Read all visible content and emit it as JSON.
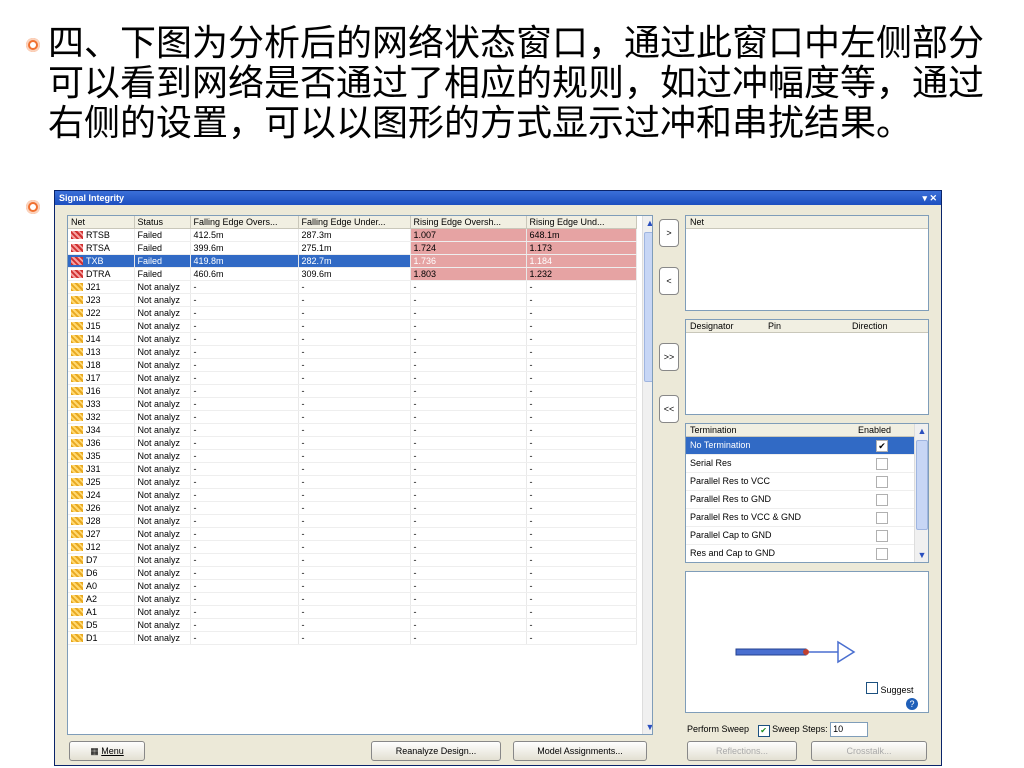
{
  "slide": {
    "text": "四、下图为分析后的网络状态窗口，通过此窗口中左侧部分可以看到网络是否通过了相应的规则，如过冲幅度等，通过右侧的设置，可以以图形的方式显示过冲和串扰结果。"
  },
  "window": {
    "title": "Signal Integrity",
    "controls": "▾ ✕"
  },
  "grid": {
    "columns": [
      "Net",
      "Status",
      "Falling Edge Overs...",
      "Falling Edge Under...",
      "Rising Edge Oversh...",
      "Rising Edge Und..."
    ],
    "rows": [
      {
        "net": "RTSB",
        "status": "Failed",
        "fo": "412.5m",
        "fu": "287.3m",
        "ro": "1.007",
        "ru": "648.1m",
        "type": "fail"
      },
      {
        "net": "RTSA",
        "status": "Failed",
        "fo": "399.6m",
        "fu": "275.1m",
        "ro": "1.724",
        "ru": "1.173",
        "type": "fail"
      },
      {
        "net": "TXB",
        "status": "Failed",
        "fo": "419.8m",
        "fu": "282.7m",
        "ro": "1.736",
        "ru": "1.184",
        "type": "fail",
        "selected": true
      },
      {
        "net": "DTRA",
        "status": "Failed",
        "fo": "460.6m",
        "fu": "309.6m",
        "ro": "1.803",
        "ru": "1.232",
        "type": "fail"
      },
      {
        "net": "J21",
        "status": "Not analyz",
        "fo": "-",
        "fu": "-",
        "ro": "-",
        "ru": "-",
        "type": "na"
      },
      {
        "net": "J23",
        "status": "Not analyz",
        "fo": "-",
        "fu": "-",
        "ro": "-",
        "ru": "-",
        "type": "na"
      },
      {
        "net": "J22",
        "status": "Not analyz",
        "fo": "-",
        "fu": "-",
        "ro": "-",
        "ru": "-",
        "type": "na"
      },
      {
        "net": "J15",
        "status": "Not analyz",
        "fo": "-",
        "fu": "-",
        "ro": "-",
        "ru": "-",
        "type": "na"
      },
      {
        "net": "J14",
        "status": "Not analyz",
        "fo": "-",
        "fu": "-",
        "ro": "-",
        "ru": "-",
        "type": "na"
      },
      {
        "net": "J13",
        "status": "Not analyz",
        "fo": "-",
        "fu": "-",
        "ro": "-",
        "ru": "-",
        "type": "na"
      },
      {
        "net": "J18",
        "status": "Not analyz",
        "fo": "-",
        "fu": "-",
        "ro": "-",
        "ru": "-",
        "type": "na"
      },
      {
        "net": "J17",
        "status": "Not analyz",
        "fo": "-",
        "fu": "-",
        "ro": "-",
        "ru": "-",
        "type": "na"
      },
      {
        "net": "J16",
        "status": "Not analyz",
        "fo": "-",
        "fu": "-",
        "ro": "-",
        "ru": "-",
        "type": "na"
      },
      {
        "net": "J33",
        "status": "Not analyz",
        "fo": "-",
        "fu": "-",
        "ro": "-",
        "ru": "-",
        "type": "na"
      },
      {
        "net": "J32",
        "status": "Not analyz",
        "fo": "-",
        "fu": "-",
        "ro": "-",
        "ru": "-",
        "type": "na"
      },
      {
        "net": "J34",
        "status": "Not analyz",
        "fo": "-",
        "fu": "-",
        "ro": "-",
        "ru": "-",
        "type": "na"
      },
      {
        "net": "J36",
        "status": "Not analyz",
        "fo": "-",
        "fu": "-",
        "ro": "-",
        "ru": "-",
        "type": "na"
      },
      {
        "net": "J35",
        "status": "Not analyz",
        "fo": "-",
        "fu": "-",
        "ro": "-",
        "ru": "-",
        "type": "na"
      },
      {
        "net": "J31",
        "status": "Not analyz",
        "fo": "-",
        "fu": "-",
        "ro": "-",
        "ru": "-",
        "type": "na"
      },
      {
        "net": "J25",
        "status": "Not analyz",
        "fo": "-",
        "fu": "-",
        "ro": "-",
        "ru": "-",
        "type": "na"
      },
      {
        "net": "J24",
        "status": "Not analyz",
        "fo": "-",
        "fu": "-",
        "ro": "-",
        "ru": "-",
        "type": "na"
      },
      {
        "net": "J26",
        "status": "Not analyz",
        "fo": "-",
        "fu": "-",
        "ro": "-",
        "ru": "-",
        "type": "na"
      },
      {
        "net": "J28",
        "status": "Not analyz",
        "fo": "-",
        "fu": "-",
        "ro": "-",
        "ru": "-",
        "type": "na"
      },
      {
        "net": "J27",
        "status": "Not analyz",
        "fo": "-",
        "fu": "-",
        "ro": "-",
        "ru": "-",
        "type": "na"
      },
      {
        "net": "J12",
        "status": "Not analyz",
        "fo": "-",
        "fu": "-",
        "ro": "-",
        "ru": "-",
        "type": "na"
      },
      {
        "net": "D7",
        "status": "Not analyz",
        "fo": "-",
        "fu": "-",
        "ro": "-",
        "ru": "-",
        "type": "na"
      },
      {
        "net": "D6",
        "status": "Not analyz",
        "fo": "-",
        "fu": "-",
        "ro": "-",
        "ru": "-",
        "type": "na"
      },
      {
        "net": "A0",
        "status": "Not analyz",
        "fo": "-",
        "fu": "-",
        "ro": "-",
        "ru": "-",
        "type": "na"
      },
      {
        "net": "A2",
        "status": "Not analyz",
        "fo": "-",
        "fu": "-",
        "ro": "-",
        "ru": "-",
        "type": "na"
      },
      {
        "net": "A1",
        "status": "Not analyz",
        "fo": "-",
        "fu": "-",
        "ro": "-",
        "ru": "-",
        "type": "na"
      },
      {
        "net": "D5",
        "status": "Not analyz",
        "fo": "-",
        "fu": "-",
        "ro": "-",
        "ru": "-",
        "type": "na"
      },
      {
        "net": "D1",
        "status": "Not analyz",
        "fo": "-",
        "fu": "-",
        "ro": "-",
        "ru": "-",
        "type": "na"
      }
    ]
  },
  "mid_buttons": [
    ">",
    "<",
    ">>",
    "<<"
  ],
  "right": {
    "net_header": "Net",
    "pin_headers": [
      "Designator",
      "Pin",
      "Direction"
    ],
    "term_headers": [
      "Termination",
      "Enabled"
    ],
    "terminations": [
      {
        "label": "No Termination",
        "checked": true,
        "selected": true
      },
      {
        "label": "Serial Res",
        "checked": false
      },
      {
        "label": "Parallel Res to VCC",
        "checked": false
      },
      {
        "label": "Parallel Res to GND",
        "checked": false
      },
      {
        "label": "Parallel Res to VCC & GND",
        "checked": false
      },
      {
        "label": "Parallel Cap to GND",
        "checked": false
      },
      {
        "label": "Res and Cap to GND",
        "checked": false
      }
    ],
    "suggest_label": "Suggest",
    "perform_sweep": "Perform Sweep",
    "sweep_steps_label": "Sweep Steps:",
    "sweep_steps_value": "10"
  },
  "bottom": {
    "menu": "Menu",
    "reanalyze": "Reanalyze Design...",
    "model": "Model Assignments...",
    "reflections": "Reflections...",
    "crosstalk": "Crosstalk..."
  }
}
